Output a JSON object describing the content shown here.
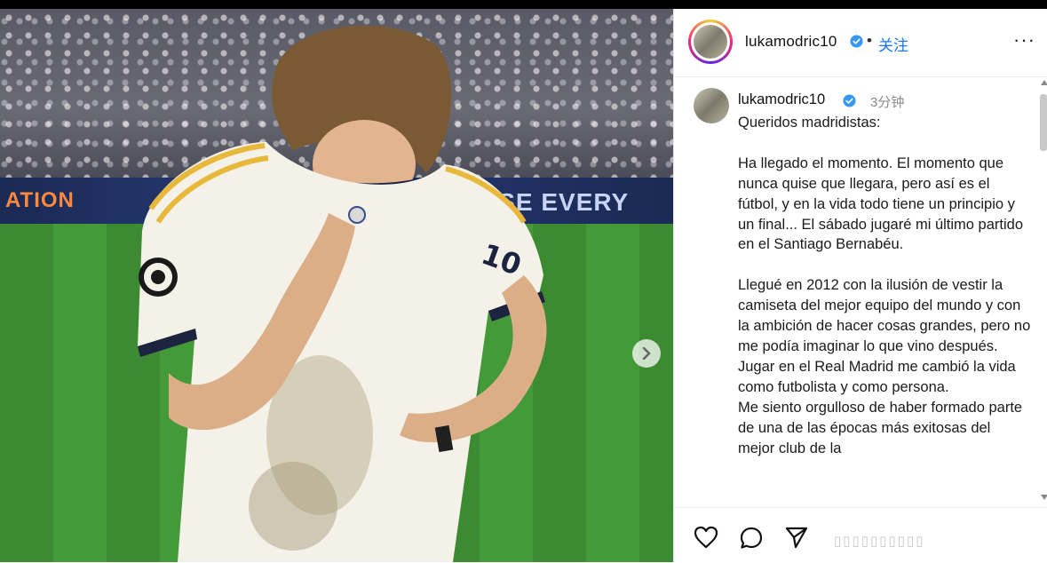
{
  "media": {
    "banner_left_text": "ATION",
    "banner_right_text": "USE EVERY CH",
    "next_icon": "chevron-right-icon"
  },
  "header": {
    "username": "lukamodric10",
    "dot": "•",
    "follow_label": "关注",
    "more_label": "···"
  },
  "post": {
    "username": "lukamodric10",
    "time": "3分钟",
    "caption": "Queridos madridistas:\n\nHa llegado el momento. El momento que nunca quise que llegara, pero así es el fútbol, y en la vida todo tiene un principio y un final... El sábado jugaré mi último partido en el Santiago Bernabéu.\n\nLlegué en 2012 con la ilusión de vestir la camiseta del mejor equipo del mundo y con la ambición de hacer cosas grandes, pero no me podía imaginar lo que vino después. Jugar en el Real Madrid me cambió la vida como futbolista y como persona.\nMe siento orgulloso de haber formado parte de una de las épocas más exitosas del mejor club de la"
  },
  "actions": {
    "icons": [
      "heart-icon",
      "comment-icon",
      "share-icon"
    ]
  },
  "colors": {
    "follow": "#1877f2",
    "verified": "#3897f0"
  }
}
